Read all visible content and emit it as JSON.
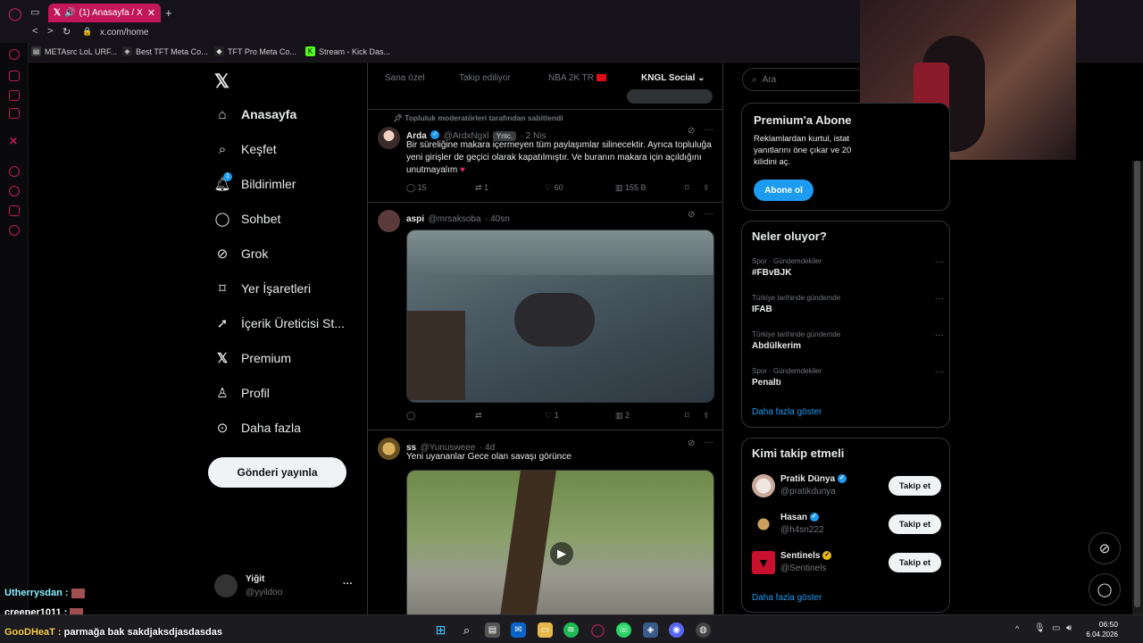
{
  "browser": {
    "tab_title": "(1) Anasayfa / X",
    "new_tab": "+",
    "url": "x.com/home",
    "bookmarks": [
      "METAsrc LoL URF...",
      "Best TFT Meta Co...",
      "TFT Pro Meta Co...",
      "Stream - Kick Das..."
    ]
  },
  "nav": {
    "items": [
      {
        "label": "Anasayfa",
        "icon": "home-icon"
      },
      {
        "label": "Keşfet",
        "icon": "search-icon"
      },
      {
        "label": "Bildirimler",
        "icon": "bell-icon",
        "badge": "1"
      },
      {
        "label": "Sohbet",
        "icon": "chat-icon"
      },
      {
        "label": "Grok",
        "icon": "grok-icon"
      },
      {
        "label": "Yer İşaretleri",
        "icon": "bookmark-icon"
      },
      {
        "label": "İçerik Üreticisi St...",
        "icon": "rocket-icon"
      },
      {
        "label": "Premium",
        "icon": "x-icon"
      },
      {
        "label": "Profil",
        "icon": "person-icon"
      },
      {
        "label": "Daha fazla",
        "icon": "more-circle-icon"
      }
    ],
    "post_button": "Gönderi yayınla",
    "account": {
      "name": "Yiğit",
      "handle": "@yyildoo",
      "more": "···"
    }
  },
  "feed": {
    "tabs": [
      "Sana özel",
      "Takip ediliyor",
      "NBA 2K TR",
      "KNGL Social"
    ],
    "pinned_label": "Topluluk moderatörleri tarafından sabitlendi",
    "posts": [
      {
        "name": "Arda",
        "handle": "@ArdxNgxl",
        "role": "Yntc.",
        "time": "· 2 Nis",
        "text": "Bir süreliğine makara içermeyen tüm paylaşımlar silinecektir. Ayrıca topluluğa yeni girişler de geçici olarak kapatılmıştır. Ve buranın makara için açıldığını unutmayalım",
        "replies": "15",
        "reposts": "1",
        "likes": "60",
        "views": "155 B"
      },
      {
        "name": "aspi",
        "handle": "@mrsaksoba",
        "time": "· 40sn",
        "replies": "",
        "reposts": "",
        "likes": "1",
        "views": "2"
      },
      {
        "name": "ss",
        "handle": "@Yunusweee",
        "time": "· 4d",
        "text": "Yeni uyananlar Gece olan savaşı görünce"
      }
    ]
  },
  "right": {
    "search_placeholder": "Ara",
    "premium": {
      "title": "Premium'a Abone",
      "text": "Reklamlardan kurtul, istat yanıtlarını öne çıkar ve 20 kilidini aç.",
      "button": "Abone ol"
    },
    "trends": {
      "title": "Neler oluyor?",
      "items": [
        {
          "category": "Spor · Gündemdekiler",
          "topic": "#FBvBJK"
        },
        {
          "category": "Türkiye tarihinde gündemde",
          "topic": "IFAB"
        },
        {
          "category": "Türkiye tarihinde gündemde",
          "topic": "Abdülkerim"
        },
        {
          "category": "Spor · Gündemdekiler",
          "topic": "Penaltı"
        }
      ],
      "more": "Daha fazla göster"
    },
    "who_to_follow": {
      "title": "Kimi takip etmeli",
      "items": [
        {
          "name": "Pratik Dünya",
          "handle": "@pratikdunya",
          "button": "Takip et"
        },
        {
          "name": "Hasan",
          "handle": "@h4sn222",
          "button": "Takip et"
        },
        {
          "name": "Sentinels",
          "handle": "@Sentinels",
          "button": "Takip et"
        }
      ],
      "more": "Daha fazla göster"
    }
  },
  "chat_overlay": [
    {
      "user": "Utherrysdan :",
      "text": ""
    },
    {
      "user": "creeper1011 :",
      "text": ""
    },
    {
      "user": "GooDHeaT :",
      "text": "parmağa bak sakdjaksdjasdasdas"
    }
  ],
  "taskbar": {
    "time": "06:50",
    "date": "6.04.2026"
  },
  "colors": {
    "accent": "#1d9bf0",
    "opera": "#c2185b",
    "background": "#000000"
  }
}
